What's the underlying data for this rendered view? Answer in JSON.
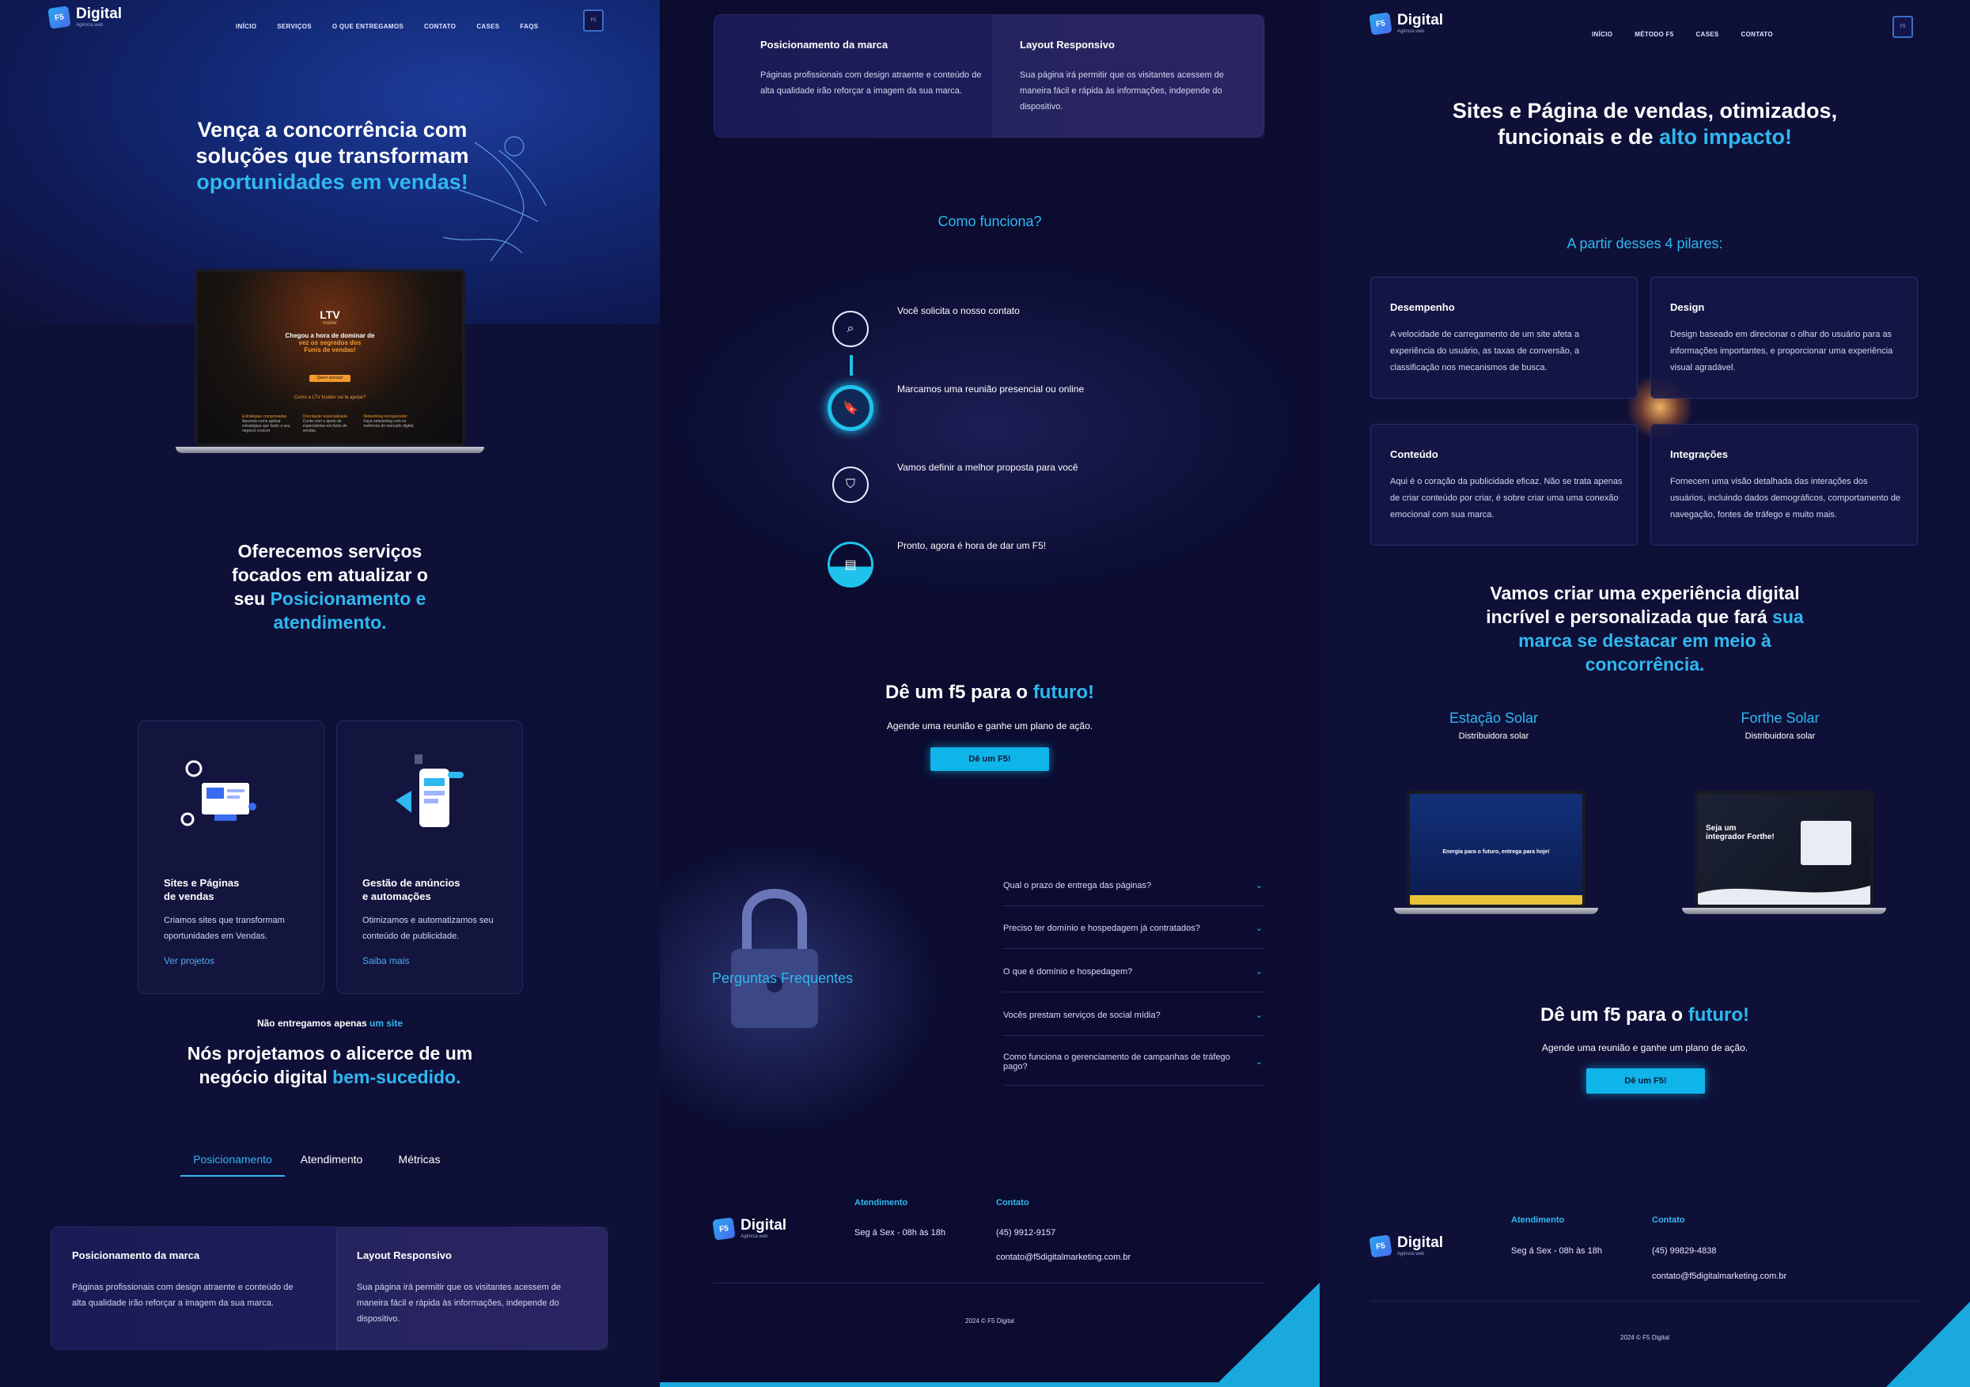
{
  "brand": {
    "logo_mark": "F5",
    "name": "Digital",
    "tagline": "Agência web"
  },
  "c1": {
    "nav": [
      "INÍCIO",
      "SERVIÇOS",
      "O QUE ENTREGAMOS",
      "CONTATO",
      "CASES",
      "FAQS"
    ],
    "menu_label": "F5",
    "hero": {
      "line1": "Vença a concorrência com",
      "line2": "soluções que transformam",
      "highlight": "oportunidades em vendas!"
    },
    "laptop_screen": {
      "logo": "LTV",
      "logo_sub": "Insider",
      "line1": "Chegou a hora de dominar de",
      "line2": "vez os segredos dos",
      "line3": "Funis de vendas!",
      "button": "Quero acessar",
      "question": "Como a LTV Insider vai te ajudar?",
      "features": [
        {
          "title": "Estratégias comprovadas",
          "text": "Aprenda como aplicar estratégias que farão o seu negócio crescer."
        },
        {
          "title": "Orientação especializada",
          "text": "Conte com o apoio de especialistas em funis de vendas."
        },
        {
          "title": "Networking enriquecedor",
          "text": "Faça networking com os melhores do mercado digital."
        }
      ]
    },
    "services_title": {
      "line1": "Oferecemos serviços",
      "line2": "focados em atualizar o",
      "line3_plain": "seu ",
      "line3_hl": "Posicionamento e",
      "line4_hl": "atendimento."
    },
    "services": [
      {
        "title_l1": "Sites e Páginas",
        "title_l2": "de vendas",
        "text": "Criamos sites que transformam oportunidades em Vendas.",
        "link": "Ver projetos"
      },
      {
        "title_l1": "Gestão de anúncios",
        "title_l2": "e automações",
        "text": "Otimizamos e automatizamos seu conteúdo de publicidade.",
        "link": "Saiba mais"
      }
    ],
    "deliver": {
      "kicker_plain": "Não entregamos apenas ",
      "kicker_hl": "um site",
      "line1": "Nós projetamos o alicerce de um",
      "line2_plain": "negócio digital ",
      "line2_hl": "bem-sucedido."
    },
    "tabs": [
      "Posicionamento",
      "Atendimento",
      "Métricas"
    ],
    "features": [
      {
        "title": "Posicionamento da marca",
        "text": "Páginas profissionais com design atraente e conteúdo de alta qualidade irão reforçar a imagem da sua marca."
      },
      {
        "title": "Layout Responsivo",
        "text": "Sua página irá permitir que os visitantes acessem de maneira fácil e rápida às informações, independe do dispositivo."
      }
    ]
  },
  "c2": {
    "features": [
      {
        "title": "Posicionamento da marca",
        "text": "Páginas profissionais com design atraente e conteúdo de alta qualidade irão reforçar a imagem da sua marca."
      },
      {
        "title": "Layout Responsivo",
        "text": "Sua página irá permitir que os visitantes acessem de maneira fácil e rápida às informações, independe do dispositivo."
      }
    ],
    "how_title": "Como funciona?",
    "steps": [
      "Você solicita o nosso contato",
      "Marcamos uma reunião presencial ou online",
      "Vamos definir a melhor proposta para você",
      "Pronto, agora é hora de dar um F5!"
    ],
    "cta": {
      "title_plain": "Dê um f5 para o ",
      "title_hl": "futuro!",
      "sub": "Agende uma reunião e ganhe um plano de ação.",
      "button": "Dê um F5!"
    },
    "faq_title": "Perguntas Frequentes",
    "faq": [
      "Qual o prazo de entrega das páginas?",
      "Preciso ter domínio e hospedagem já contratados?",
      "O que é domínio e hospedagem?",
      "Vocês prestam serviços de social mídia?",
      "Como funciona o gerenciamento de campanhas de tráfego pago?"
    ],
    "footer": {
      "hours_title": "Atendimento",
      "hours": "Seg á Sex - 08h às 18h",
      "contact_title": "Contato",
      "phone": "(45) 9912-9157",
      "email": "contato@f5digitalmarketing.com.br",
      "copyright": "2024 © F5 Digital"
    }
  },
  "c3": {
    "nav": [
      "INÍCIO",
      "MÉTODO F5",
      "CASES",
      "CONTATO"
    ],
    "menu_label": "F5",
    "hero": {
      "line1": "Sites e Página de vendas, otimizados,",
      "line2_plain": "funcionais e de ",
      "line2_hl": "alto impacto!"
    },
    "pillars_title": "A partir desses 4 pilares:",
    "pillars": [
      {
        "title": "Desempenho",
        "text": "A velocidade de carregamento de um site afeta a experiência do usuário, as taxas de conversão, a classificação nos mecanismos de busca."
      },
      {
        "title": "Design",
        "text": "Design baseado em direcionar o olhar do usuário para as informações importantes, e proporcionar uma experiência visual agradável."
      },
      {
        "title": "Conteúdo",
        "text": "Aqui é o coração da publicidade eficaz. Não se trata apenas de criar conteúdo por criar, é sobre criar uma uma conexão emocional com sua marca."
      },
      {
        "title": "Integrações",
        "text": "Fornecem uma visão detalhada das interações dos usuários, incluindo dados demográficos, comportamento de navegação, fontes de tráfego e muito mais."
      }
    ],
    "exp": {
      "line1": "Vamos criar uma experiência digital",
      "line2_plain": "incrível e personalizada que fará ",
      "line2_hl": "sua",
      "line3_hl": "marca se destacar em meio à",
      "line4_hl": "concorrência."
    },
    "cases": [
      {
        "name": "Estação Solar",
        "sub": "Distribuidora solar",
        "screen_text": "Energia para o futuro, entrega para hoje!"
      },
      {
        "name": "Forthe Solar",
        "sub": "Distribuidora solar",
        "screen_text": "Seja um integrador Forthe!"
      }
    ],
    "cta": {
      "title_plain": "Dê um f5 para o ",
      "title_hl": "futuro!",
      "sub": "Agende uma reunião e ganhe um plano de ação.",
      "button": "Dê um F5!"
    },
    "footer": {
      "hours_title": "Atendimento",
      "hours": "Seg á Sex - 08h às 18h",
      "contact_title": "Contato",
      "phone": "(45) 99829-4838",
      "email": "contato@f5digitalmarketing.com.br",
      "copyright": "2024 © F5 Digital"
    }
  },
  "colors": {
    "accent": "#2fb8f0",
    "button": "#0fb4e8",
    "bg": "#0f1038",
    "card": "#13153f"
  }
}
